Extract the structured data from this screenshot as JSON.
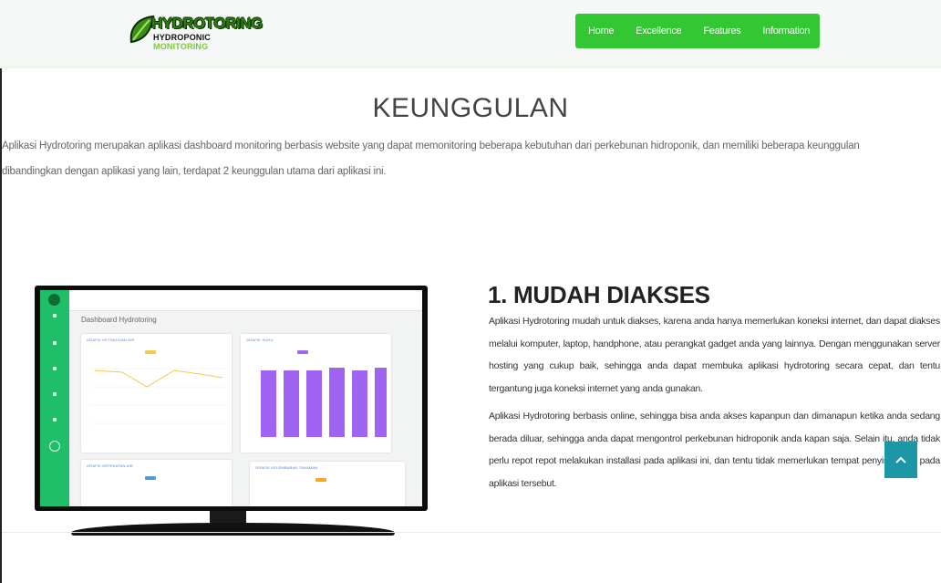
{
  "brand": {
    "logo_title": "HYDROTORING",
    "logo_sub_a": "HYDROPONIC",
    "logo_sub_b": "MONITORING",
    "colors": {
      "green": "#34c734",
      "leaf": "#2e7d0f",
      "accent": "#1b97a5",
      "bar": "#a064f2"
    }
  },
  "nav": {
    "items": [
      {
        "label": "Home"
      },
      {
        "label": "Excellence"
      },
      {
        "label": "Features"
      },
      {
        "label": "Information"
      }
    ]
  },
  "page": {
    "title": "KEUNGGULAN",
    "intro_line1": "Aplikasi Hydrotoring merupakan aplikasi dashboard monitoring berbasis website yang dapat memonitoring beberapa kebutuhan dari perkebunan hidroponik, dan memiliki beberapa keunggulan",
    "intro_line2": "dibandingkan dengan aplikasi yang lain, terdapat 2 keunggulan utama dari aplikasi ini."
  },
  "section1": {
    "heading": "1. MUDAH DIAKSES",
    "paragraph1": "Aplikasi Hydrotoring mudah untuk diakses, karena anda hanya memerlukan koneksi internet, dan dapat diakses melalui komputer, laptop, handphone, atau perangkat gadget anda yang lainnya. Dengan menggunakan server hosting yang cukup baik, sehingga anda dapat membuka aplikasi hydrotoring secara cepat, dan tentu tergantung juga koneksi internet yang anda gunakan.",
    "paragraph2": "Aplikasi Hydrotoring berbasis online, sehingga bisa anda akses kapanpun dan dimanapun ketika anda sedang berada diluar, sehingga anda dapat mengontrol perkebunan hidroponik anda kapan saja. Selain itu, anda tidak perlu repot repot melakukan installasi pada aplikasi ini, dan tentu tidak memerlukan tempat penyimpanan pada aplikasi tersebut."
  },
  "mockup": {
    "dashboard_title": "Dashboard Hydrotoring",
    "card1_title": "GRAFIK KETINGGIAN AIR",
    "card2_title": "GRAFIK SUHU",
    "card3_title": "GRAFIK KEPEKATAN AIR",
    "card4_title": "GRAFIK KELEMBABAN TANAMAN"
  },
  "icons": {
    "scroll_top": "chevron-up-icon",
    "logo": "leaf-icon"
  }
}
